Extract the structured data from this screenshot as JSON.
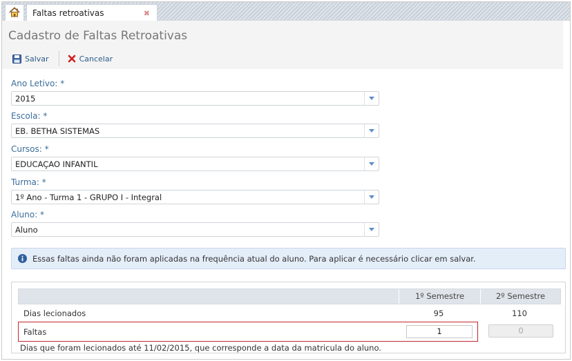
{
  "tabs": {
    "home_icon": "home-icon",
    "active_tab_label": "Faltas retroativas",
    "close_glyph": "✖"
  },
  "page": {
    "title": "Cadastro de Faltas Retroativas"
  },
  "toolbar": {
    "save_label": "Salvar",
    "cancel_label": "Cancelar"
  },
  "form": {
    "ano_letivo": {
      "label": "Ano Letivo:",
      "required": "*",
      "value": "2015"
    },
    "escola": {
      "label": "Escola:",
      "required": "*",
      "value": "EB. BETHA SISTEMAS"
    },
    "cursos": {
      "label": "Cursos:",
      "required": "*",
      "value": "EDUCAÇAO INFANTIL"
    },
    "turma": {
      "label": "Turma:",
      "required": "*",
      "value": "1º Ano - Turma 1 - GRUPO I - Integral"
    },
    "aluno": {
      "label": "Aluno:",
      "required": "*",
      "value": "Aluno"
    }
  },
  "info": {
    "text": "Essas faltas ainda não foram aplicadas na frequência atual do aluno. Para aplicar é necessário clicar em salvar."
  },
  "table": {
    "col1": "1º Semestre",
    "col2": "2º Semestre",
    "dias_label": "Dias lecionados",
    "dias_s1": "95",
    "dias_s2": "110",
    "faltas_label": "Faltas",
    "faltas_s1": "1",
    "faltas_s2": "0",
    "note": "Dias que foram lecionados até 11/02/2015, que corresponde a data da matricula do aluno."
  },
  "colors": {
    "accent": "#3a6d9a",
    "highlight": "#c1272d",
    "info_bg": "#e4eef9"
  }
}
